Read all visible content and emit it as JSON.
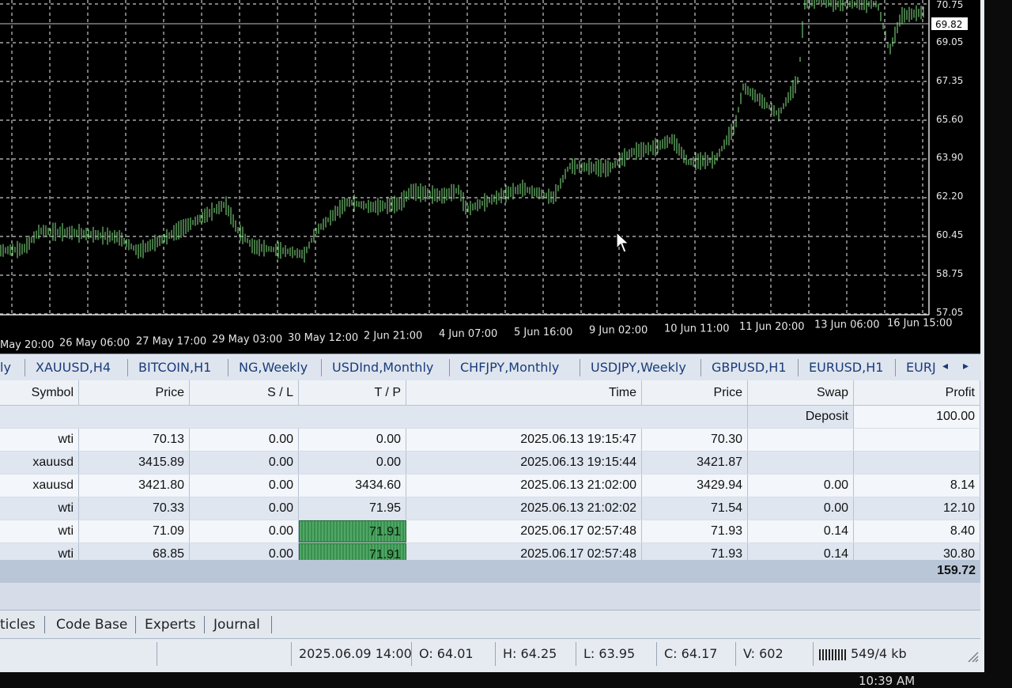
{
  "chart": {
    "price_axis": [
      "70.75",
      "69.05",
      "67.35",
      "65.60",
      "63.90",
      "62.20",
      "60.45",
      "58.75",
      "57.05"
    ],
    "current_price": "69.82",
    "time_axis": [
      "May 20:00",
      "26 May 06:00",
      "27 May 17:00",
      "29 May 03:00",
      "30 May 12:00",
      "2 Jun 21:00",
      "4 Jun 07:00",
      "5 Jun 16:00",
      "9 Jun 02:00",
      "10 Jun 11:00",
      "11 Jun 20:00",
      "13 Jun 06:00",
      "16 Jun 15:00"
    ],
    "colors": {
      "background": "#000000",
      "grid": "#c8c8c8",
      "bars": "#7dd47d",
      "price_tag": "#ffffff"
    }
  },
  "symbol_tabs": [
    "ly",
    "XAUUSD,H4",
    "BITCOIN,H1",
    "NG,Weekly",
    "USDInd,Monthly",
    "CHFJPY,Monthly",
    "USDJPY,Weekly",
    "GBPUSD,H1",
    "EURUSD,H1",
    "EURJ"
  ],
  "trade_table": {
    "headers": {
      "symbol": "Symbol",
      "price": "Price",
      "sl": "S / L",
      "tp": "T / P",
      "time": "Time",
      "price2": "Price",
      "swap": "Swap",
      "profit": "Profit"
    },
    "deposit_label": "Deposit",
    "deposit_value": "100.00",
    "rows": [
      {
        "symbol": "wti",
        "price": "70.13",
        "sl": "0.00",
        "tp": "0.00",
        "time": "2025.06.13 19:15:47",
        "price2": "70.30",
        "swap": "",
        "profit": "",
        "tp_hit": false
      },
      {
        "symbol": "xauusd",
        "price": "3415.89",
        "sl": "0.00",
        "tp": "0.00",
        "time": "2025.06.13 19:15:44",
        "price2": "3421.87",
        "swap": "",
        "profit": "",
        "tp_hit": false
      },
      {
        "symbol": "xauusd",
        "price": "3421.80",
        "sl": "0.00",
        "tp": "3434.60",
        "time": "2025.06.13 21:02:00",
        "price2": "3429.94",
        "swap": "0.00",
        "profit": "8.14",
        "tp_hit": false
      },
      {
        "symbol": "wti",
        "price": "70.33",
        "sl": "0.00",
        "tp": "71.95",
        "time": "2025.06.13 21:02:02",
        "price2": "71.54",
        "swap": "0.00",
        "profit": "12.10",
        "tp_hit": false
      },
      {
        "symbol": "wti",
        "price": "71.09",
        "sl": "0.00",
        "tp": "71.91",
        "time": "2025.06.17 02:57:48",
        "price2": "71.93",
        "swap": "0.14",
        "profit": "8.40",
        "tp_hit": true
      },
      {
        "symbol": "wti",
        "price": "68.85",
        "sl": "0.00",
        "tp": "71.91",
        "time": "2025.06.17 02:57:48",
        "price2": "71.93",
        "swap": "0.14",
        "profit": "30.80",
        "tp_hit": true
      }
    ],
    "total_profit": "159.72"
  },
  "bottom_tabs": [
    "ticles",
    "Code Base",
    "Experts",
    "Journal"
  ],
  "status_bar": {
    "datetime": "2025.06.09 14:00",
    "open": "O: 64.01",
    "high": "H: 64.25",
    "low": "L: 63.95",
    "close": "C: 64.17",
    "volume": "V: 602",
    "traffic": "549/4 kb"
  },
  "clock": "10:39 AM"
}
